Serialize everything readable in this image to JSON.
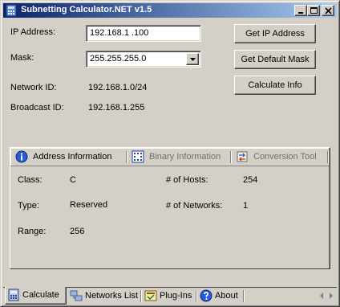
{
  "window": {
    "title": "Subnetting Calculator.NET v1.5",
    "controls": {
      "minimize": "minimize-icon",
      "maximize": "maximize-icon",
      "close": "close-icon"
    }
  },
  "form": {
    "ip_label": "IP Address:",
    "ip_value": "192.168.1  .100",
    "mask_label": "Mask:",
    "mask_value": "255.255.255.0",
    "network_label": "Network ID:",
    "network_value": "192.168.1.0/24",
    "broadcast_label": "Broadcast ID:",
    "broadcast_value": "192.168.1.255"
  },
  "buttons": {
    "get_ip": "Get IP Address",
    "get_mask": "Get Default Mask",
    "calculate": "Calculate Info"
  },
  "tabs": [
    {
      "label": "Address Information",
      "icon": "info-icon",
      "active": true
    },
    {
      "label": "Binary Information",
      "icon": "binary-grid-icon",
      "active": false
    },
    {
      "label": "Conversion Tool",
      "icon": "conversion-icon",
      "active": false
    }
  ],
  "info": {
    "class_label": "Class:",
    "class_value": "C",
    "type_label": "Type:",
    "type_value": "Reserved",
    "range_label": "Range:",
    "range_value": "256",
    "hosts_label": "# of Hosts:",
    "hosts_value": "254",
    "networks_label": "# of Networks:",
    "networks_value": "1"
  },
  "bottom_tabs": [
    {
      "label": "Calculate",
      "icon": "calculator-icon",
      "active": true
    },
    {
      "label": "Networks List",
      "icon": "network-icon",
      "active": false
    },
    {
      "label": "Plug-Ins",
      "icon": "plugin-icon",
      "active": false
    },
    {
      "label": "About",
      "icon": "help-icon",
      "active": false
    }
  ],
  "colors": {
    "window_face": "#d4d0c8",
    "title_gradient_start": "#0a246a",
    "title_gradient_end": "#a6caf0",
    "inactive_tab_text": "#6f6f6f"
  }
}
